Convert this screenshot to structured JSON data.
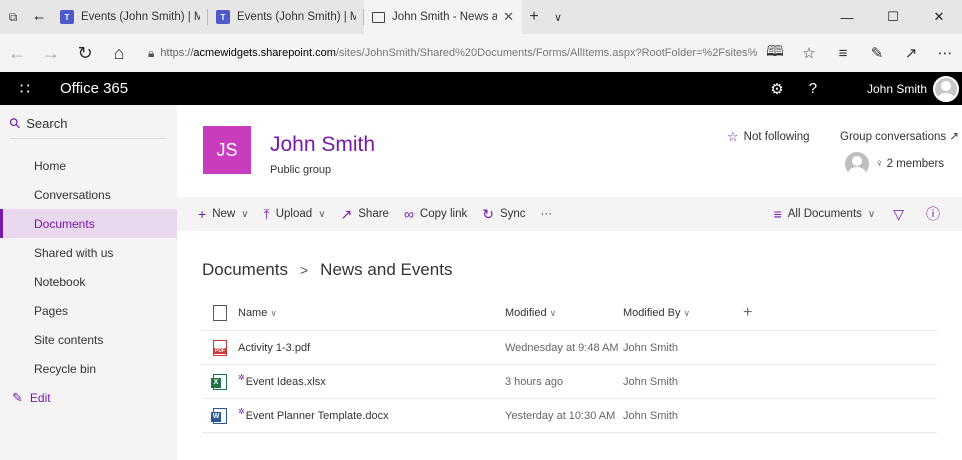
{
  "browser": {
    "tabs": [
      {
        "title": "Events (John Smith) | Micros",
        "active": false,
        "icon": "teams-icon"
      },
      {
        "title": "Events (John Smith) | Micros",
        "active": false,
        "icon": "teams-icon"
      },
      {
        "title": "John Smith - News and",
        "active": true,
        "icon": "page-icon"
      }
    ],
    "address": {
      "scheme": "https://",
      "host": "acmewidgets.sharepoint.com",
      "path": "/sites/JohnSmith/Shared%20Documents/Forms/AllItems.aspx?RootFolder=%2Fsites%"
    }
  },
  "suite": {
    "title": "Office 365",
    "user_name": "John Smith"
  },
  "leftnav": {
    "search_label": "Search",
    "items": [
      {
        "label": "Home",
        "active": false
      },
      {
        "label": "Conversations",
        "active": false
      },
      {
        "label": "Documents",
        "active": true
      },
      {
        "label": "Shared with us",
        "active": false
      },
      {
        "label": "Notebook",
        "active": false
      },
      {
        "label": "Pages",
        "active": false
      },
      {
        "label": "Site contents",
        "active": false
      },
      {
        "label": "Recycle bin",
        "active": false
      }
    ],
    "edit_label": "Edit"
  },
  "site": {
    "logo_initials": "JS",
    "title": "John Smith",
    "subtitle": "Public group",
    "follow_label": "Not following",
    "group_conversations_label": "Group conversations",
    "members_label": "2 members"
  },
  "commandbar": {
    "new_label": "New",
    "upload_label": "Upload",
    "share_label": "Share",
    "copylink_label": "Copy link",
    "sync_label": "Sync",
    "more_label": "···",
    "view_label": "All Documents"
  },
  "breadcrumb": {
    "root": "Documents",
    "separator": ">",
    "current": "News and Events"
  },
  "doclist": {
    "columns": {
      "name": "Name",
      "modified": "Modified",
      "modified_by": "Modified By",
      "add": "+"
    },
    "rows": [
      {
        "name": "Activity 1-3.pdf",
        "modified": "Wednesday at 9:48 AM",
        "modified_by": "John Smith",
        "type": "pdf",
        "new": false
      },
      {
        "name": "Event Ideas.xlsx",
        "modified": "3 hours ago",
        "modified_by": "John Smith",
        "type": "xlsx",
        "new": true
      },
      {
        "name": "Event Planner Template.docx",
        "modified": "Yesterday at 10:30 AM",
        "modified_by": "John Smith",
        "type": "docx",
        "new": true
      }
    ]
  },
  "colors": {
    "accent": "#7719aa",
    "logo_bg": "#c83cbd",
    "suitebar_bg": "#000000",
    "nav_active_bg": "#e9d8ee"
  }
}
